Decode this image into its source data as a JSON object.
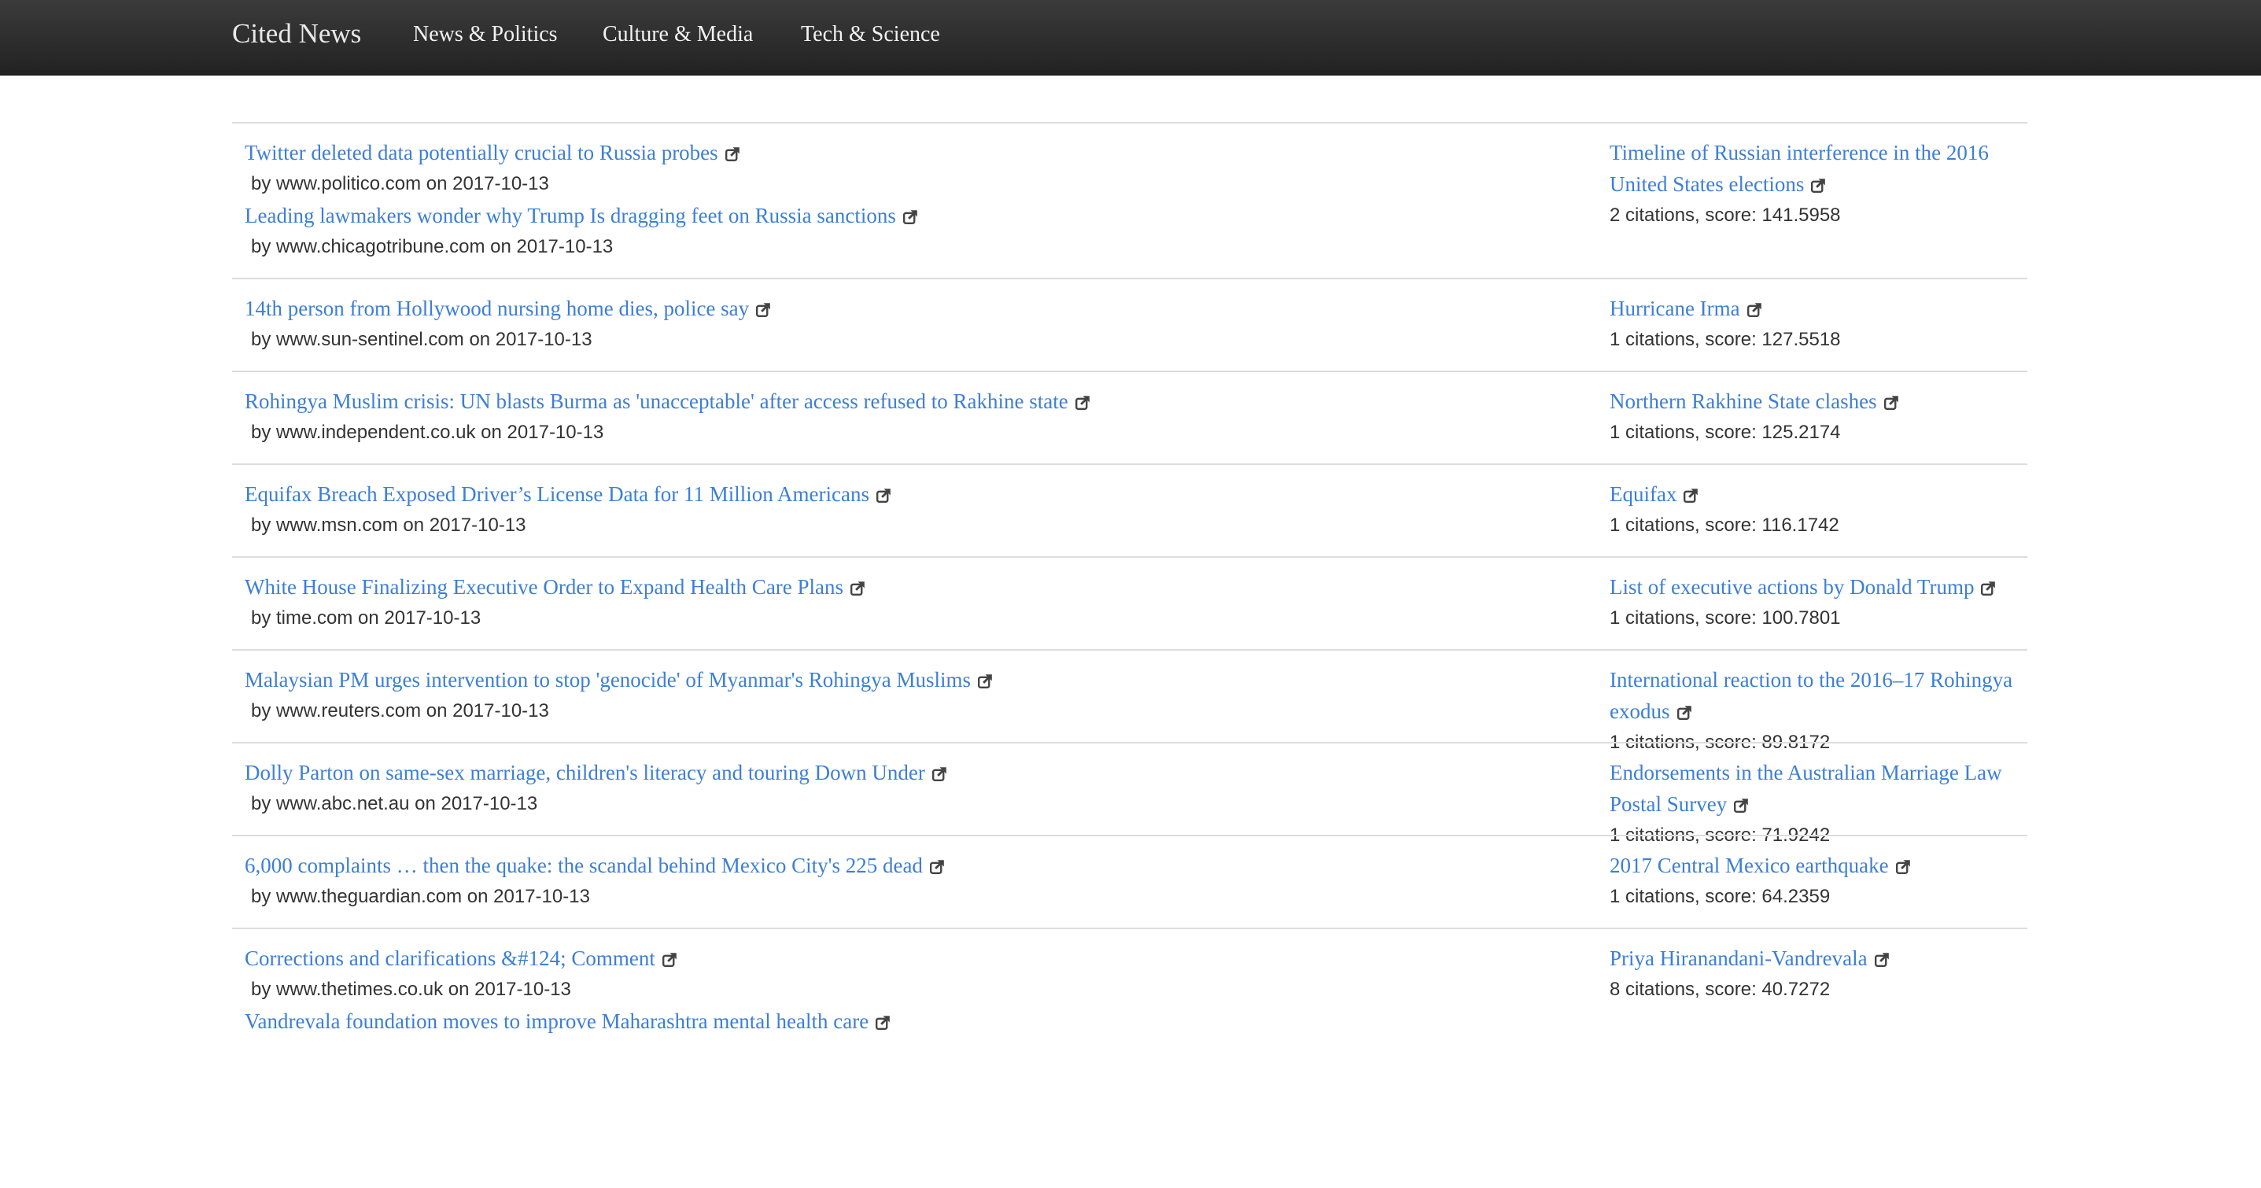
{
  "navbar": {
    "brand": "Cited News",
    "links": [
      "News & Politics",
      "Culture & Media",
      "Tech & Science"
    ]
  },
  "colors": {
    "link": "#3c7fd6",
    "navbar_bg": "#2b2b2b",
    "text": "#333333",
    "divider": "#dddddd"
  },
  "icons": {
    "external_link": "external-link-icon"
  },
  "entries": [
    {
      "articles": [
        {
          "title": "Twitter deleted data potentially crucial to Russia probes",
          "byline": "by www.politico.com on 2017-10-13"
        },
        {
          "title": "Leading lawmakers wonder why Trump Is dragging feet on Russia sanctions",
          "byline": "by www.chicagotribune.com on 2017-10-13"
        }
      ],
      "topic": {
        "title": "Timeline of Russian interference in the 2016 United States elections",
        "stats": "2 citations, score: 141.5958"
      }
    },
    {
      "articles": [
        {
          "title": "14th person from Hollywood nursing home dies, police say",
          "byline": "by www.sun-sentinel.com on 2017-10-13"
        }
      ],
      "topic": {
        "title": "Hurricane Irma",
        "stats": "1 citations, score: 127.5518"
      }
    },
    {
      "articles": [
        {
          "title": "Rohingya Muslim crisis: UN blasts Burma as 'unacceptable' after access refused to Rakhine state",
          "byline": "by www.independent.co.uk on 2017-10-13"
        }
      ],
      "topic": {
        "title": "Northern Rakhine State clashes",
        "stats": "1 citations, score: 125.2174"
      }
    },
    {
      "articles": [
        {
          "title": "Equifax Breach Exposed Driver’s License Data for 11 Million Americans",
          "byline": "by www.msn.com on 2017-10-13"
        }
      ],
      "topic": {
        "title": "Equifax",
        "stats": "1 citations, score: 116.1742"
      }
    },
    {
      "articles": [
        {
          "title": "White House Finalizing Executive Order to Expand Health Care Plans",
          "byline": "by time.com on 2017-10-13"
        }
      ],
      "topic": {
        "title": "List of executive actions by Donald Trump",
        "stats": "1 citations, score: 100.7801"
      }
    },
    {
      "articles": [
        {
          "title": "Malaysian PM urges intervention to stop 'genocide' of Myanmar's Rohingya Muslims",
          "byline": "by www.reuters.com on 2017-10-13"
        }
      ],
      "topic": {
        "title": "International reaction to the 2016–17 Rohingya exodus",
        "stats": "1 citations, score: 89.8172"
      }
    },
    {
      "articles": [
        {
          "title": "Dolly Parton on same-sex marriage, children's literacy and touring Down Under",
          "byline": "by www.abc.net.au on 2017-10-13"
        }
      ],
      "topic": {
        "title": "Endorsements in the Australian Marriage Law Postal Survey",
        "stats": "1 citations, score: 71.9242"
      }
    },
    {
      "articles": [
        {
          "title": "6,000 complaints … then the quake: the scandal behind Mexico City's 225 dead",
          "byline": "by www.theguardian.com on 2017-10-13"
        }
      ],
      "topic": {
        "title": "2017 Central Mexico earthquake",
        "stats": "1 citations, score: 64.2359"
      }
    },
    {
      "articles": [
        {
          "title": "Corrections and clarifications &#124; Comment",
          "byline": "by www.thetimes.co.uk on 2017-10-13"
        },
        {
          "title": "Vandrevala foundation moves to improve Maharashtra mental health care",
          "byline": ""
        }
      ],
      "topic": {
        "title": "Priya Hiranandani-Vandrevala",
        "stats": "8 citations, score: 40.7272"
      }
    }
  ]
}
